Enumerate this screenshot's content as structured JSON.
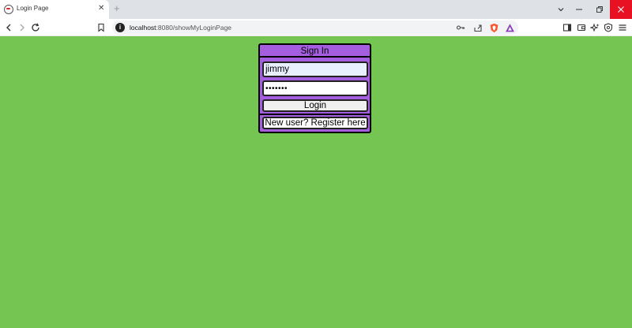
{
  "browser": {
    "tab": {
      "title": "Login Page",
      "close_glyph": "✕",
      "favicon": "page-favicon-icon"
    },
    "new_tab_glyph": "+",
    "address": {
      "host": "localhost",
      "path": ":8080/showMyLoginPage"
    },
    "window_controls": [
      "tab-search-icon",
      "minimize-icon",
      "restore-icon",
      "close-icon"
    ],
    "toolbar_icons": [
      "back-icon",
      "forward-icon",
      "reload-icon",
      "bookmark-icon",
      "key-icon",
      "share-icon",
      "brave-shields-icon",
      "brave-rewards-icon",
      "sidebar-icon",
      "wallet-icon",
      "leo-icon",
      "vpn-icon",
      "menu-icon"
    ]
  },
  "login": {
    "header": "Sign In",
    "username_value": "jimmy",
    "password_value": "•••••••",
    "login_label": "Login",
    "register_label": "New user? Register here"
  },
  "colors": {
    "page_background": "#74c552",
    "form_background": "#a65ee0",
    "close_button": "#e81123"
  }
}
